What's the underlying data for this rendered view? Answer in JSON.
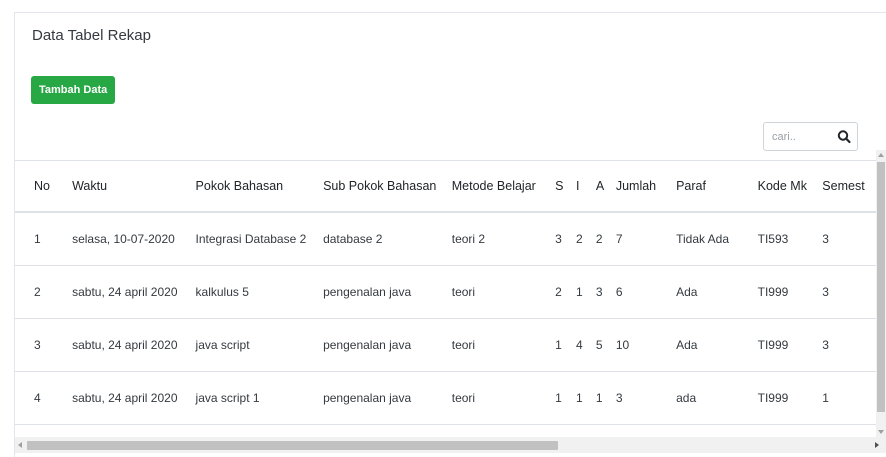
{
  "card": {
    "title": "Data Tabel Rekap"
  },
  "toolbar": {
    "add_label": "Tambah Data"
  },
  "search": {
    "placeholder": "cari..",
    "icon": "search-icon"
  },
  "table": {
    "columns": [
      "No",
      "Waktu",
      "Pokok Bahasan",
      "Sub Pokok Bahasan",
      "Metode Belajar",
      "S",
      "I",
      "A",
      "Jumlah",
      "Paraf",
      "Kode Mk",
      "Semest"
    ],
    "rows": [
      [
        "1",
        "selasa, 10-07-2020",
        "Integrasi Database 2",
        "database 2",
        "teori 2",
        "3",
        "2",
        "2",
        "7",
        "Tidak Ada",
        "TI593",
        "3"
      ],
      [
        "2",
        "sabtu, 24 april 2020",
        "kalkulus 5",
        "pengenalan java",
        "teori",
        "2",
        "1",
        "3",
        "6",
        "Ada",
        "TI999",
        "3"
      ],
      [
        "3",
        "sabtu, 24 april 2020",
        "java script",
        "pengenalan java",
        "teori",
        "1",
        "4",
        "5",
        "10",
        "Ada",
        "TI999",
        "3"
      ],
      [
        "4",
        "sabtu, 24 april 2020",
        "java script 1",
        "pengenalan java",
        "teori",
        "1",
        "1",
        "1",
        "3",
        "ada",
        "TI999",
        "1"
      ]
    ]
  },
  "colors": {
    "add_button": "#28a745",
    "border": "#dee2e6"
  }
}
